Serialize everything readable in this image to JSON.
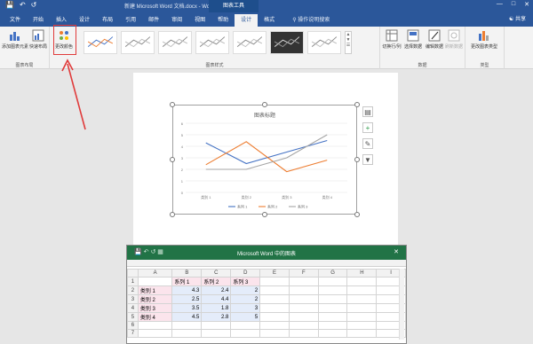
{
  "titlebar": {
    "doc_title": "新建 Microsoft Word 文档.docx - Word",
    "tools_label": "图表工具",
    "quick_access": [
      "save",
      "undo",
      "redo"
    ]
  },
  "tabs": {
    "items": [
      "文件",
      "开始",
      "插入",
      "设计",
      "布局",
      "引用",
      "邮件",
      "审阅",
      "视图",
      "帮助",
      "设计",
      "格式"
    ],
    "active_index": 10,
    "search": "操作说明搜索",
    "share": "共享"
  },
  "ribbon": {
    "btn_add_element": "添加图表元素",
    "btn_quick_layout": "快速布局",
    "btn_change_colors": "更改颜色",
    "group_layout": "图表布局",
    "group_styles": "图表样式",
    "btn_switch_row_col": "切换行/列",
    "btn_select_data": "选择数据",
    "btn_edit_data": "编辑数据",
    "btn_refresh_data": "刷新数据",
    "group_data": "数据",
    "btn_change_type": "更改图表类型",
    "group_type": "类型"
  },
  "chart_data": {
    "type": "line",
    "title": "图表标题",
    "categories": [
      "类别 1",
      "类别 2",
      "类别 3",
      "类别 4"
    ],
    "series": [
      {
        "name": "系列 1",
        "values": [
          4.3,
          2.5,
          3.5,
          4.5
        ],
        "color": "#4472c4"
      },
      {
        "name": "系列 2",
        "values": [
          2.4,
          4.4,
          1.8,
          2.8
        ],
        "color": "#ed7d31"
      },
      {
        "name": "系列 3",
        "values": [
          2,
          2,
          3,
          5
        ],
        "color": "#a5a5a5"
      }
    ],
    "ylim": [
      0,
      6
    ],
    "yticks": [
      "6",
      "5",
      "4",
      "3",
      "2",
      "1",
      "0"
    ],
    "legend": "bottom",
    "grid": true
  },
  "excel": {
    "title": "Microsoft Word 中的图表",
    "columns": [
      "",
      "A",
      "B",
      "C",
      "D",
      "E",
      "F",
      "G",
      "H",
      "I"
    ],
    "rows": [
      {
        "n": "1",
        "cells": [
          "",
          "系列 1",
          "系列 2",
          "系列 3",
          "",
          "",
          "",
          "",
          ""
        ]
      },
      {
        "n": "2",
        "cells": [
          "类别 1",
          "4.3",
          "2.4",
          "2",
          "",
          "",
          "",
          "",
          ""
        ]
      },
      {
        "n": "3",
        "cells": [
          "类别 2",
          "2.5",
          "4.4",
          "2",
          "",
          "",
          "",
          "",
          ""
        ]
      },
      {
        "n": "4",
        "cells": [
          "类别 3",
          "3.5",
          "1.8",
          "3",
          "",
          "",
          "",
          "",
          ""
        ]
      },
      {
        "n": "5",
        "cells": [
          "类别 4",
          "4.5",
          "2.8",
          "5",
          "",
          "",
          "",
          "",
          ""
        ]
      },
      {
        "n": "6",
        "cells": [
          "",
          "",
          "",
          "",
          "",
          "",
          "",
          "",
          ""
        ]
      },
      {
        "n": "7",
        "cells": [
          "",
          "",
          "",
          "",
          "",
          "",
          "",
          "",
          ""
        ]
      }
    ]
  },
  "colors": {
    "word_blue": "#2b579a",
    "excel_green": "#217346",
    "annotation_red": "#e03b3b"
  }
}
